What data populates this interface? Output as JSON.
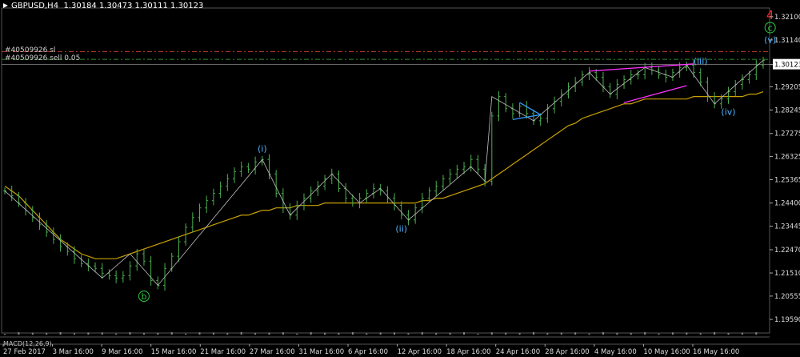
{
  "header": {
    "symbol": "GBPUSD,H4",
    "ohlc": "1.30184 1.30473 1.30111 1.30123"
  },
  "orders": {
    "sl_label": "#40509926 sl",
    "entry_label": "#40509926 sell 0.05",
    "sl_price": 1.3066,
    "entry_price": 1.3034,
    "sl_color": "#c0392b",
    "entry_color": "#2e8b2e"
  },
  "chart_data": {
    "type": "line",
    "title": "",
    "xlabel": "",
    "ylabel": "",
    "ylim": [
      1.1903,
      1.3246
    ],
    "price_axis_ticks": [
      "1.32100",
      "1.31140",
      "1.30123",
      "1.29205",
      "1.28245",
      "1.27275",
      "1.26325",
      "1.25365",
      "1.24400",
      "1.23445",
      "1.22470",
      "1.21510",
      "1.20555",
      "1.19590"
    ],
    "current_price": "1.30123",
    "time_ticks": [
      "27 Feb 2017",
      "3 Mar 16:00",
      "9 Mar 16:00",
      "15 Mar 16:00",
      "21 Mar 16:00",
      "27 Mar 16:00",
      "31 Mar 16:00",
      "6 Apr 16:00",
      "12 Apr 16:00",
      "18 Apr 16:00",
      "24 Apr 16:00",
      "28 Apr 16:00",
      "4 May 16:00",
      "10 May 16:00",
      "16 May 16:00"
    ],
    "series": [
      {
        "values": [
          1.249,
          1.247,
          1.244,
          1.241,
          1.238,
          1.235,
          1.232,
          1.229,
          1.226,
          1.224,
          1.221,
          1.219,
          1.218,
          1.217,
          1.215,
          1.214,
          1.213,
          1.214,
          1.218,
          1.223,
          1.22,
          1.212,
          1.21,
          1.217,
          1.222,
          1.228,
          1.234,
          1.238,
          1.242,
          1.245,
          1.248,
          1.251,
          1.254,
          1.257,
          1.259,
          1.258,
          1.261,
          1.262,
          1.256,
          1.248,
          1.242,
          1.239,
          1.243,
          1.246,
          1.249,
          1.251,
          1.254,
          1.256,
          1.25,
          1.246,
          1.244,
          1.246,
          1.248,
          1.25,
          1.249,
          1.246,
          1.243,
          1.239,
          1.237,
          1.242,
          1.246,
          1.249,
          1.251,
          1.254,
          1.256,
          1.258,
          1.259,
          1.262,
          1.258,
          1.253,
          1.28,
          1.288,
          1.283,
          1.281,
          1.284,
          1.281,
          1.278,
          1.279,
          1.283,
          1.286,
          1.289,
          1.292,
          1.294,
          1.297,
          1.298,
          1.296,
          1.292,
          1.289,
          1.293,
          1.295,
          1.297,
          1.297,
          1.3,
          1.299,
          1.297,
          1.296,
          1.298,
          1.3,
          1.301,
          1.298,
          1.294,
          1.288,
          1.285,
          1.287,
          1.29,
          1.293,
          1.295,
          1.297,
          1.301,
          1.303
        ]
      },
      {
        "values": [
          1.251,
          1.249,
          1.247,
          1.244,
          1.241,
          1.238,
          1.235,
          1.232,
          1.229,
          1.227,
          1.225,
          1.223,
          1.222,
          1.221,
          1.221,
          1.221,
          1.221,
          1.222,
          1.223,
          1.224,
          1.225,
          1.226,
          1.227,
          1.228,
          1.229,
          1.23,
          1.231,
          1.232,
          1.233,
          1.234,
          1.235,
          1.236,
          1.237,
          1.238,
          1.239,
          1.239,
          1.24,
          1.241,
          1.241,
          1.242,
          1.242,
          1.242,
          1.243,
          1.243,
          1.243,
          1.243,
          1.244,
          1.244,
          1.244,
          1.244,
          1.244,
          1.244,
          1.244,
          1.244,
          1.244,
          1.244,
          1.244,
          1.244,
          1.244,
          1.244,
          1.245,
          1.245,
          1.246,
          1.246,
          1.247,
          1.248,
          1.249,
          1.25,
          1.251,
          1.252,
          1.254,
          1.256,
          1.258,
          1.26,
          1.262,
          1.264,
          1.266,
          1.268,
          1.27,
          1.272,
          1.274,
          1.276,
          1.277,
          1.279,
          1.28,
          1.281,
          1.282,
          1.283,
          1.284,
          1.285,
          1.285,
          1.286,
          1.287,
          1.287,
          1.287,
          1.287,
          1.287,
          1.287,
          1.287,
          1.288,
          1.288,
          1.288,
          1.288,
          1.288,
          1.288,
          1.288,
          1.288,
          1.289,
          1.289,
          1.29
        ]
      }
    ],
    "wave_labels": [
      {
        "text": "(i)",
        "x": 37,
        "y": 1.2665,
        "color": "#4fb3ff"
      },
      {
        "text": "(ii)",
        "x": 57,
        "y": 1.2335,
        "color": "#4fb3ff"
      },
      {
        "text": "(iii)",
        "x": 100,
        "y": 1.3028,
        "color": "#4fb3ff"
      },
      {
        "text": "(iv)",
        "x": 104,
        "y": 1.2818,
        "color": "#4fb3ff"
      },
      {
        "text": "(v)",
        "x": 110,
        "y": 1.3115,
        "color": "#4fb3ff"
      },
      {
        "text": "b",
        "x": 20,
        "y": 1.2055,
        "color": "#2ecc40"
      },
      {
        "text": "c",
        "x": 110,
        "y": 1.3165,
        "color": "#2ecc40"
      },
      {
        "text": "4",
        "x": 110,
        "y": 1.3213,
        "color": "#ff2222"
      }
    ],
    "colors": {
      "candles": "#4caf50",
      "ma": "#c8a000",
      "trendline_magenta": "#ff33ff",
      "trendline_blue": "#3399ff",
      "wave_line": "#c0c0c0"
    }
  }
}
